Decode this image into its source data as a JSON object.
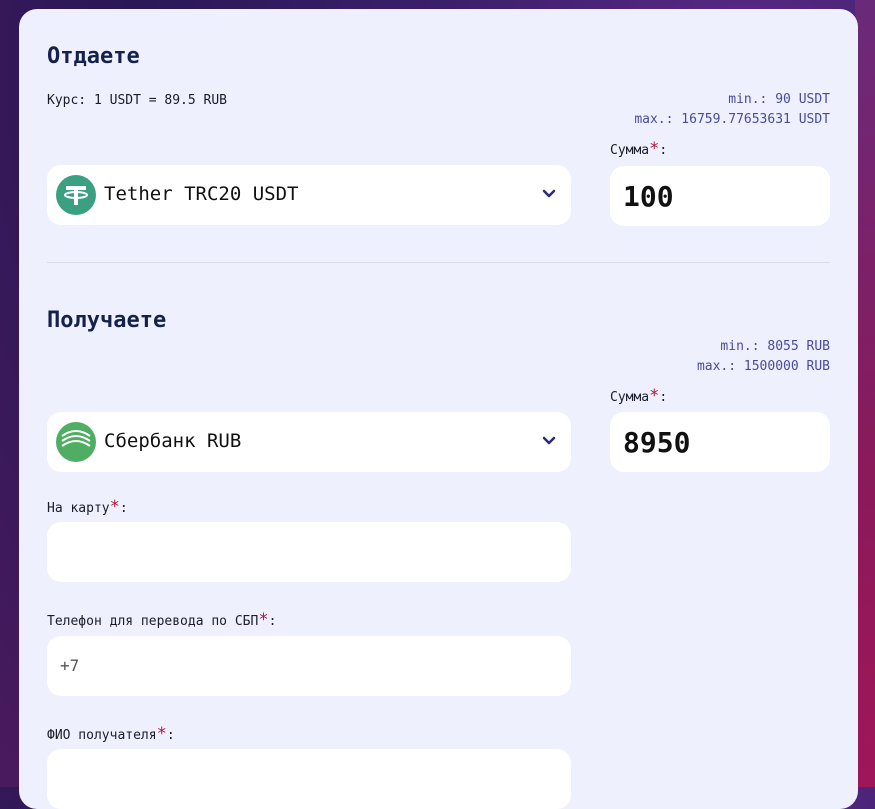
{
  "give": {
    "title": "Отдаете",
    "rate": "Курс: 1 USDT = 89.5 RUB",
    "min": "min.: 90 USDT",
    "max": "max.: 16759.77653631 USDT",
    "currency": "Tether TRC20 USDT",
    "amount_label": "Сумма",
    "amount_value": "100",
    "coin_color": "#3aa07f"
  },
  "receive": {
    "title": "Получаете",
    "min": "min.: 8055 RUB",
    "max": "max.: 1500000 RUB",
    "currency": "Сбербанк RUB",
    "amount_label": "Сумма",
    "amount_value": "8950",
    "coin_color": "#4fae63"
  },
  "fields": {
    "card_label": "На карту",
    "card_value": "",
    "phone_label": "Телефон для перевода по СБП",
    "phone_value": "+7",
    "name_label": "ФИО получателя",
    "name_value": ""
  },
  "required_mark": "*",
  "colon": ":"
}
